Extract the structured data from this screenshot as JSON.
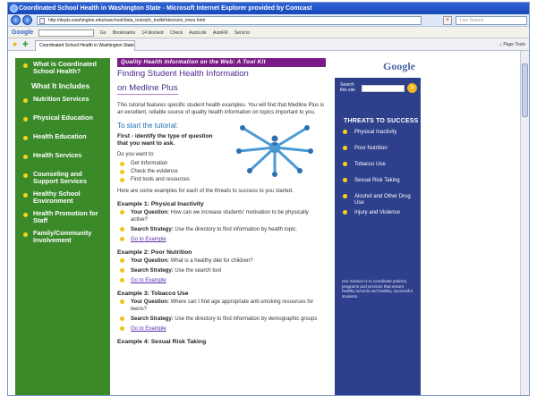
{
  "window": {
    "title": "Coordinated School Health in Washington State - Microsoft Internet Explorer provided by Comcast"
  },
  "addressbar": {
    "url": "http://depts.washington.edu/waschool/data_tools/ph_toolkit/decision_trees.html",
    "search_placeholder": "Live Search"
  },
  "google_toolbar": {
    "logo": "Google",
    "items": [
      "Go",
      "Bookmarks",
      "14 blocked",
      "Check",
      "AutoLink",
      "AutoFill",
      "Send to"
    ]
  },
  "tab": {
    "label": "Coordinated School Health in Washington State"
  },
  "command_bar": {
    "page": "Page",
    "tools": "Tools"
  },
  "leftnav": {
    "top": "What is Coordinated School Health?",
    "heading": "What It Includes",
    "items": [
      "Nutrition Services",
      "Physical Education",
      "Health Education",
      "Health Services",
      "Counseling and Support Services",
      "Healthy School Environment",
      "Health Promotion for Staff",
      "Family/Community Involvement"
    ]
  },
  "content": {
    "banner": "Quality Health Information on the Web: A Tool Kit",
    "title_line1": "Finding Student Health Information",
    "title_line2": "on Medline Plus",
    "intro": "This tutorial features specific student health examples. You will find that Medline Plus is an excellent, reliable source of quality health information on topics important to you.",
    "start_heading": "To start the tutorial:",
    "first_step": "First - identify the type of question that you want to ask.",
    "do_you_want": "Do you want to:",
    "options": [
      "Get Information",
      "Check the evidence",
      "Find tools and resources"
    ],
    "examples_intro": "Here are some examples for each of the threats to success to you started.",
    "examples": [
      {
        "heading": "Example 1: Physical Inactivity",
        "question_label": "Your Question:",
        "question": "How can we increase students' motivation to be physically active?",
        "strategy_label": "Search Strategy:",
        "strategy": "Use the directory to find information by health topic.",
        "link": "Go to Example"
      },
      {
        "heading": "Example 2: Poor Nutrition",
        "question_label": "Your Question:",
        "question": "What is a healthy diet for children?",
        "strategy_label": "Search Strategy:",
        "strategy": "Use the search tool",
        "link": "Go to Example"
      },
      {
        "heading": "Example 3: Tobacco Use",
        "question_label": "Your Question:",
        "question": "Where can I find age appropriate anti-smoking resources for teens?",
        "strategy_label": "Search Strategy:",
        "strategy": "Use the directory to find information by demographic groups",
        "link": "Go to Example"
      }
    ],
    "example4_heading": "Example 4: Sexual Risk Taking"
  },
  "rightpanel": {
    "google": "Google",
    "search_label": "Search this site",
    "go": ">",
    "threats_heading": "THREATS TO SUCCESS",
    "threats": [
      "Physical Inactivity",
      "Poor Nutrition",
      "Tobacco Use",
      "Sexual Risk Taking",
      "Alcohol and Other Drug Use",
      "Injury and Violence"
    ],
    "mission": "Our mission is to coordinate policies, programs and services that ensure healthy schools and healthy, successful students."
  },
  "colors": {
    "nav_green": "#3a8a2a",
    "banner_purple": "#7a1c87",
    "panel_blue": "#2e3f8c",
    "bullet_yellow": "#f0c419"
  }
}
